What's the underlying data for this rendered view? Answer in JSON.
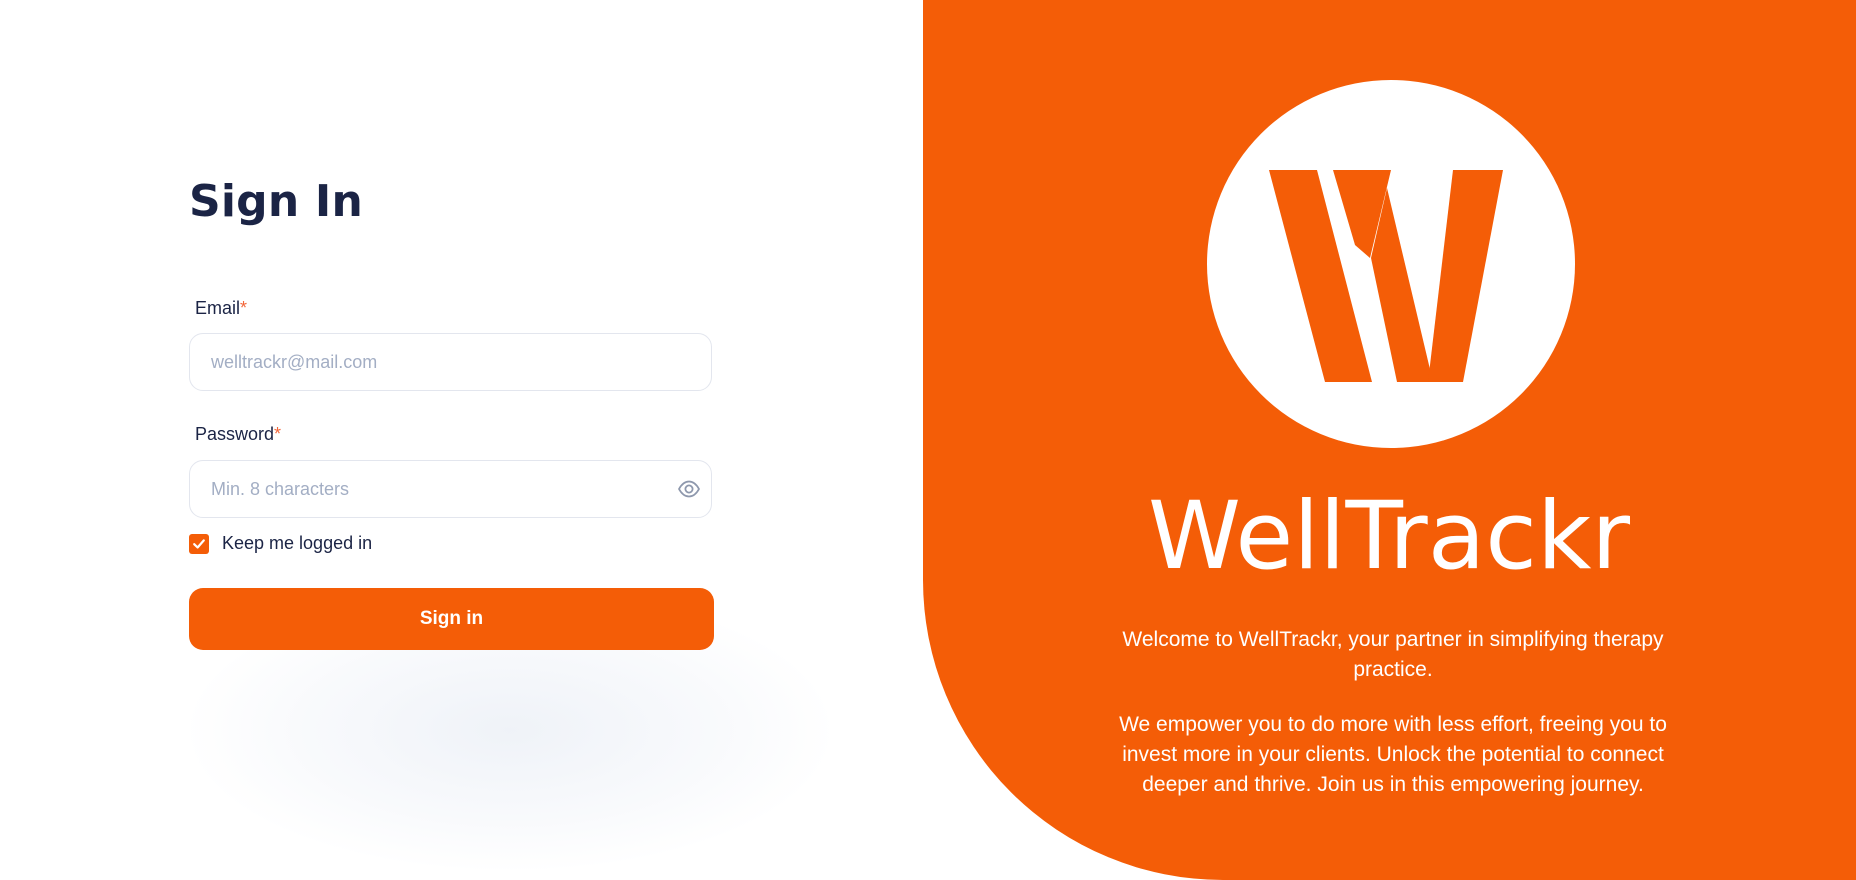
{
  "signin": {
    "title": "Sign In",
    "email_label": "Email",
    "email_placeholder": "welltrackr@mail.com",
    "password_label": "Password",
    "password_placeholder": "Min. 8 characters",
    "required_mark": "*",
    "keep_logged_in_label": "Keep me logged in",
    "keep_logged_in_checked": true,
    "submit_label": "Sign in"
  },
  "brand": {
    "name": "WellTrackr",
    "logo_letter": "W",
    "welcome": "Welcome to WellTrackr, your partner in simplifying therapy practice.",
    "mission": "We empower you to do more with less effort, freeing you to invest more in your clients. Unlock the potential to connect deeper and thrive. Join us in this empowering journey."
  },
  "icons": {
    "password_toggle": "eye-icon",
    "checkbox": "checkmark-icon",
    "logo": "welltrackr-w-logo"
  },
  "colors": {
    "accent": "#f45d07",
    "title": "#1b2445",
    "required": "#f2663a",
    "placeholder": "#a3aec4",
    "input_border": "#e3e6ee",
    "panel_text": "#ffffff"
  }
}
